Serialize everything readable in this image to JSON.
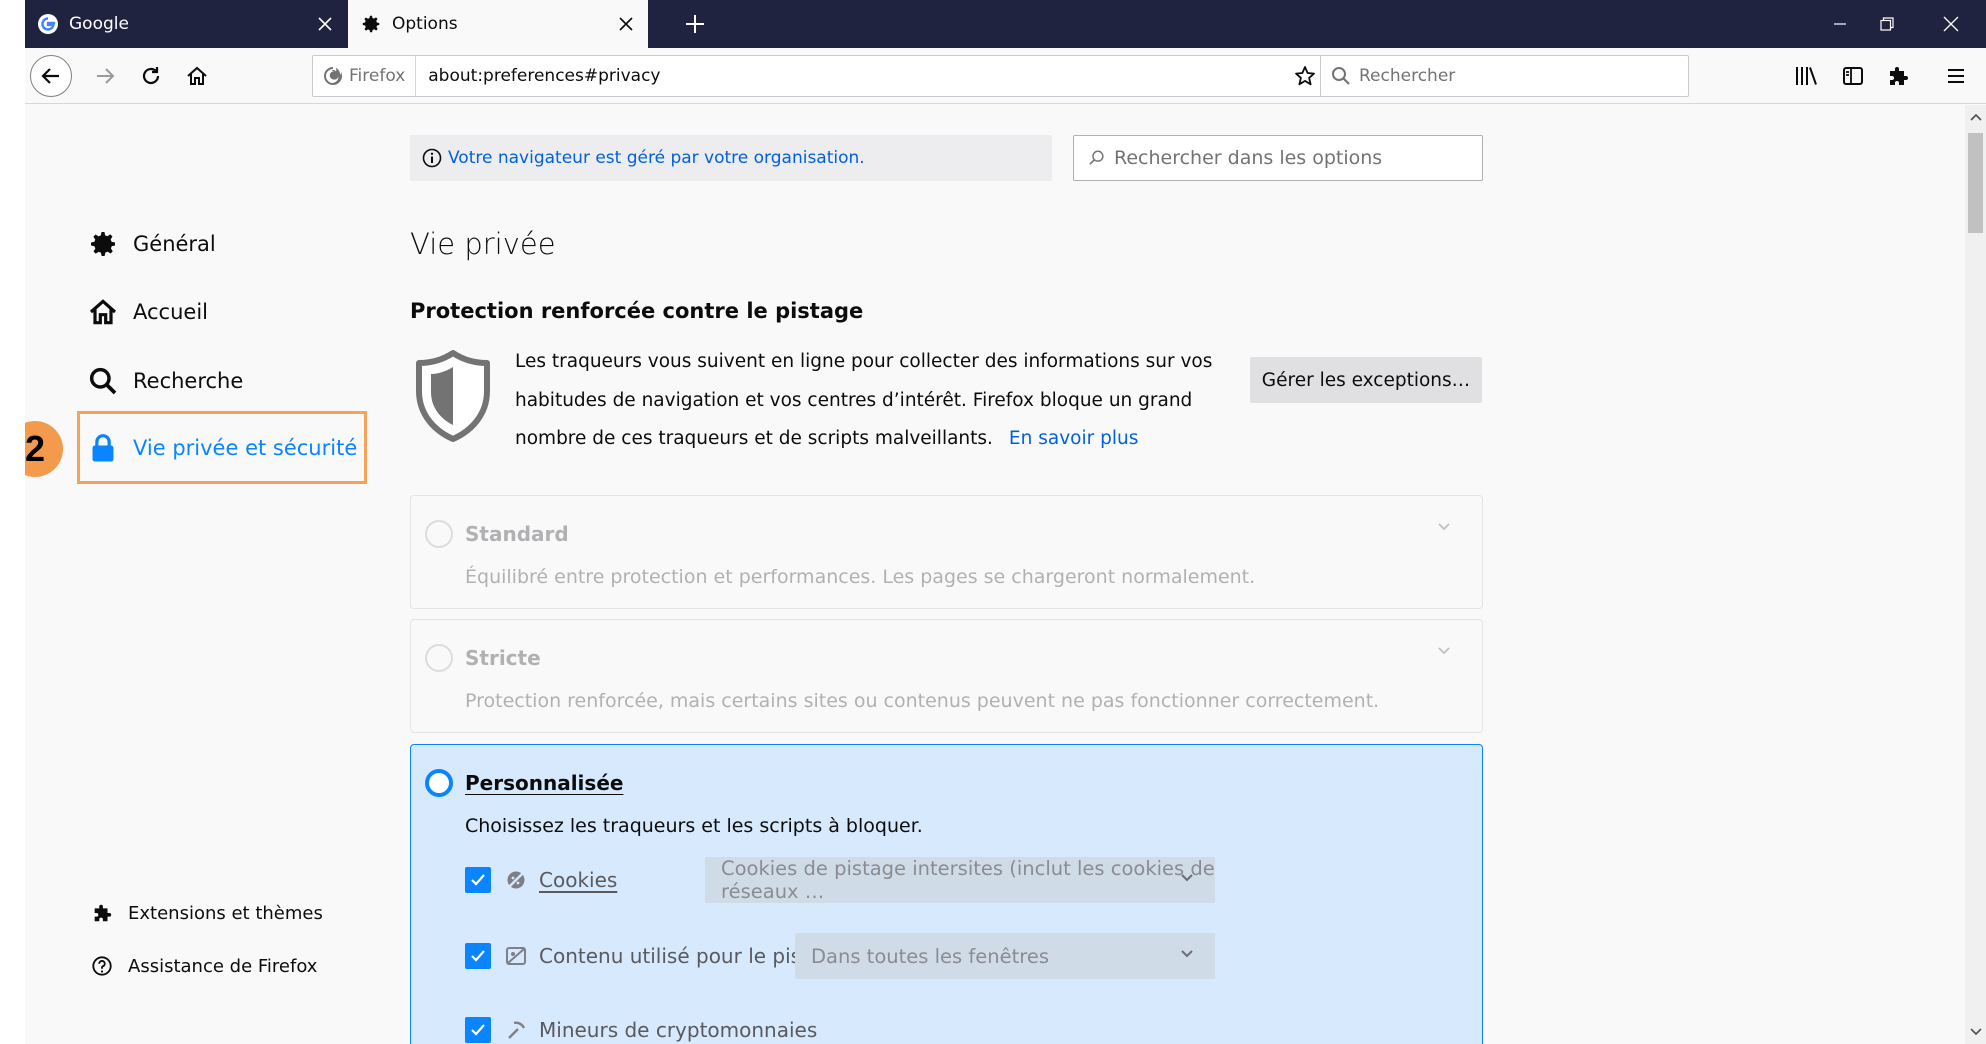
{
  "tabs": [
    {
      "label": "Google",
      "favicon": "google-g-icon"
    },
    {
      "label": "Options",
      "favicon": "gear-icon"
    }
  ],
  "navbar": {
    "identity_label": "Firefox",
    "url": "about:preferences#privacy",
    "search_placeholder": "Rechercher"
  },
  "managed_notice": "Votre navigateur est géré par votre organisation.",
  "prefs_search_placeholder": "Rechercher dans les options",
  "sidebar": {
    "items": [
      {
        "label": "Général",
        "icon": "gear-icon"
      },
      {
        "label": "Accueil",
        "icon": "home-icon"
      },
      {
        "label": "Recherche",
        "icon": "search-icon"
      },
      {
        "label": "Vie privée et sécurité",
        "icon": "lock-icon",
        "selected": true
      }
    ],
    "footer": [
      {
        "label": "Extensions et thèmes",
        "icon": "puzzle-icon"
      },
      {
        "label": "Assistance de Firefox",
        "icon": "help-icon"
      }
    ],
    "step_badge": "2"
  },
  "page": {
    "title": "Vie privée",
    "section_title": "Protection renforcée contre le pistage",
    "description": "Les traqueurs vous suivent en ligne pour collecter des informations sur vos habitudes de navigation et vos centres d’intérêt. Firefox bloque un grand nombre de ces traqueurs et de scripts malveillants.",
    "learn_more": "En savoir plus",
    "exceptions_button": "Gérer les exceptions…"
  },
  "options": [
    {
      "title": "Standard",
      "subtitle": "Équilibré entre protection et performances. Les pages se chargeront normalement.",
      "selected": false
    },
    {
      "title": "Stricte",
      "subtitle": "Protection renforcée, mais certains sites ou contenus peuvent ne pas fonctionner correctement.",
      "selected": false
    },
    {
      "title": "Personnalisée",
      "subtitle": "Choisissez les traqueurs et les scripts à bloquer.",
      "selected": true
    }
  ],
  "custom": {
    "rows": [
      {
        "label": "Cookies",
        "checked": true,
        "select_value": "Cookies de pistage intersites (inclut les cookies de réseaux …"
      },
      {
        "label": "Contenu utilisé pour le pistage",
        "checked": true,
        "select_value": "Dans toutes les fenêtres"
      },
      {
        "label": "Mineurs de cryptomonnaies",
        "checked": true
      }
    ]
  },
  "colors": {
    "accent": "#0a84ff",
    "link": "#0060df",
    "highlight": "#f4a35a",
    "tabstrip": "#202340"
  }
}
